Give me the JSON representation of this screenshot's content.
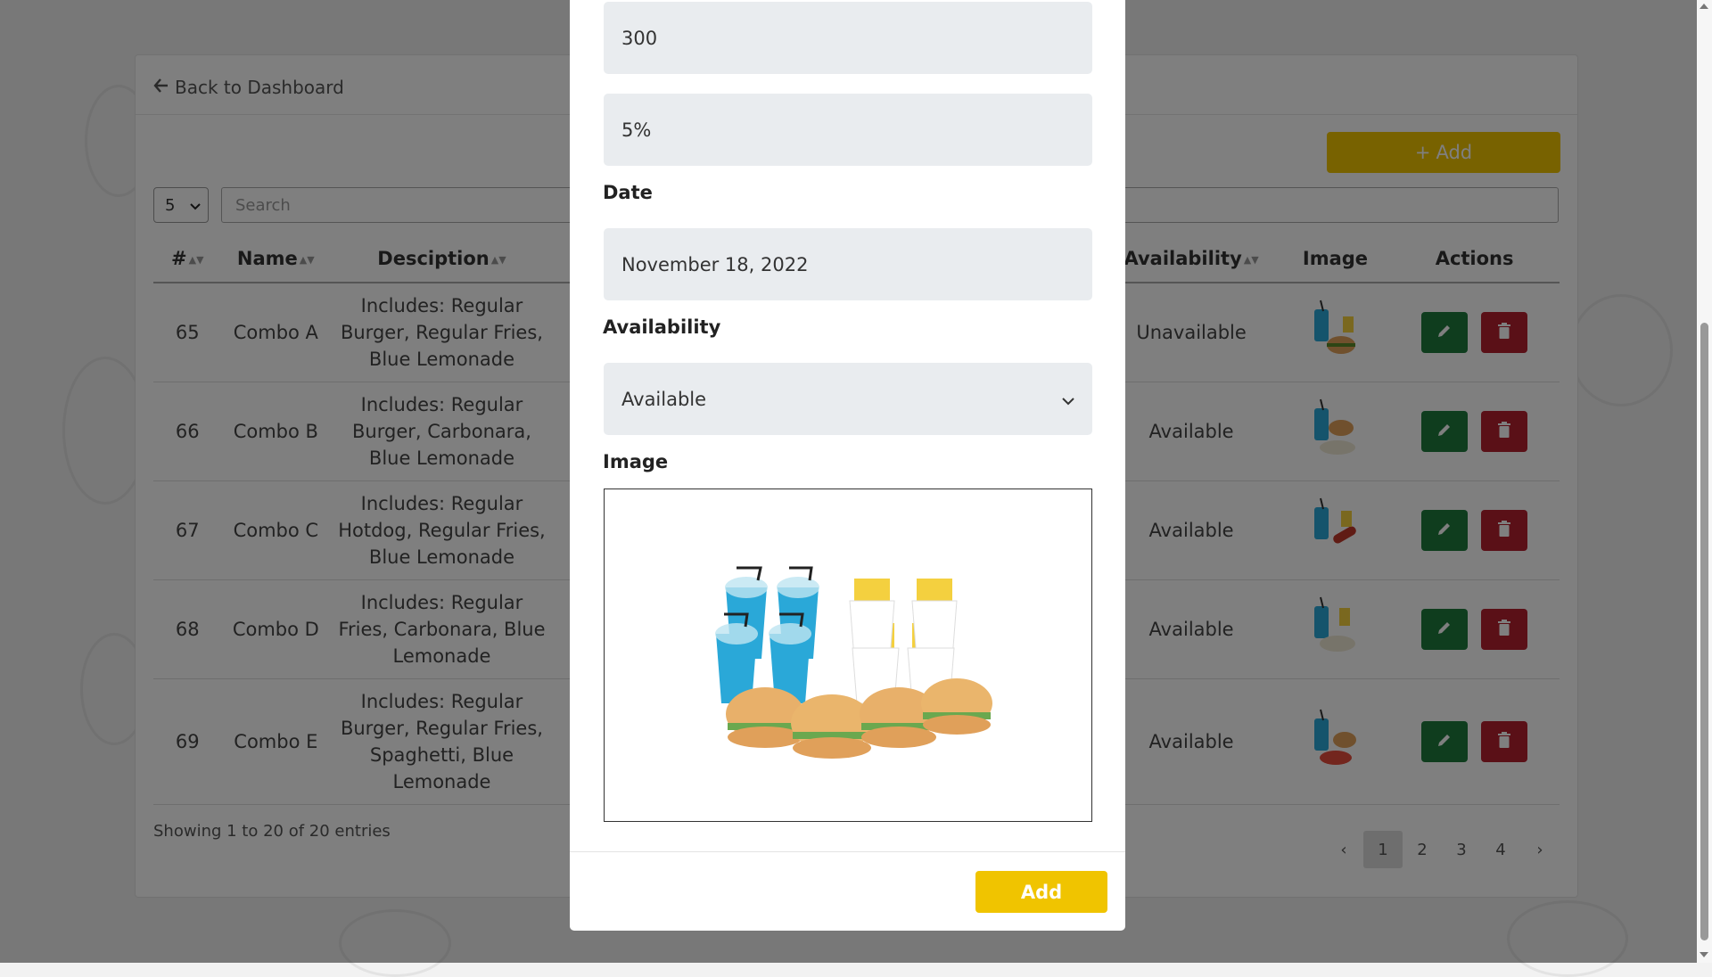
{
  "page": {
    "back_label": "Back to Dashboard",
    "add_label": "Add",
    "entries_value": "5",
    "search_placeholder": "Search",
    "columns": {
      "num": "#",
      "name": "Name",
      "description": "Desciption",
      "availability": "Availability",
      "image": "Image",
      "actions": "Actions"
    },
    "rows": [
      {
        "num": "65",
        "name": "Combo A",
        "description": "Includes: Regular Burger, Regular Fries, Blue Lemonade",
        "availability": "Unavailable",
        "image_icon": "combo-burger-fries-icon"
      },
      {
        "num": "66",
        "name": "Combo B",
        "description": "Includes: Regular Burger, Carbonara, Blue Lemonade",
        "availability": "Available",
        "image_icon": "combo-burger-pasta-icon"
      },
      {
        "num": "67",
        "name": "Combo C",
        "description": "Includes: Regular Hotdog, Regular Fries, Blue Lemonade",
        "availability": "Available",
        "image_icon": "combo-hotdog-fries-icon"
      },
      {
        "num": "68",
        "name": "Combo D",
        "description": "Includes: Regular Fries, Carbonara, Blue Lemonade",
        "availability": "Available",
        "image_icon": "combo-fries-pasta-icon"
      },
      {
        "num": "69",
        "name": "Combo E",
        "description": "Includes: Regular Burger, Regular Fries, Spaghetti, Blue Lemonade",
        "availability": "Available",
        "image_icon": "combo-burger-spaghetti-icon"
      }
    ],
    "showing_text": "Showing 1 to 20 of 20 entries",
    "pagination": {
      "prev": "‹",
      "pages": [
        "1",
        "2",
        "3",
        "4"
      ],
      "next": "›",
      "active": "1"
    }
  },
  "modal": {
    "price_value": "300",
    "discount_value": "5%",
    "date_label": "Date",
    "date_value": "November 18, 2022",
    "availability_label": "Availability",
    "availability_value": "Available",
    "image_label": "Image",
    "image_icon": "combo-meal-preview-image",
    "add_button_label": "Add"
  },
  "colors": {
    "accent_yellow": "#f0c400",
    "edit_green": "#1e7a3c",
    "delete_red": "#b5202e",
    "overlay": "rgba(0,0,0,0.5)"
  }
}
